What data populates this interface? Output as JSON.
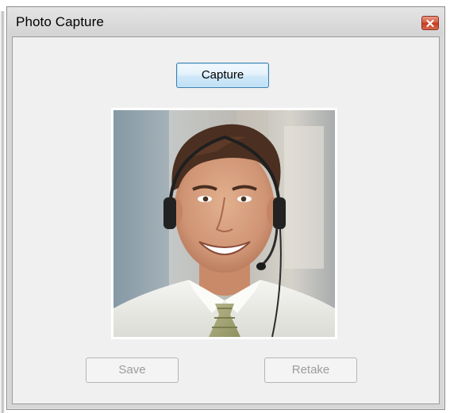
{
  "window": {
    "title": "Photo Capture"
  },
  "buttons": {
    "capture": "Capture",
    "save": "Save",
    "retake": "Retake"
  },
  "photo": {
    "subject": "smiling man wearing a headset"
  },
  "colors": {
    "close_button": "#d5553b",
    "capture_border": "#3c7fb1",
    "client_background": "#f0f0f0"
  },
  "icons": {
    "close": "close-icon"
  }
}
